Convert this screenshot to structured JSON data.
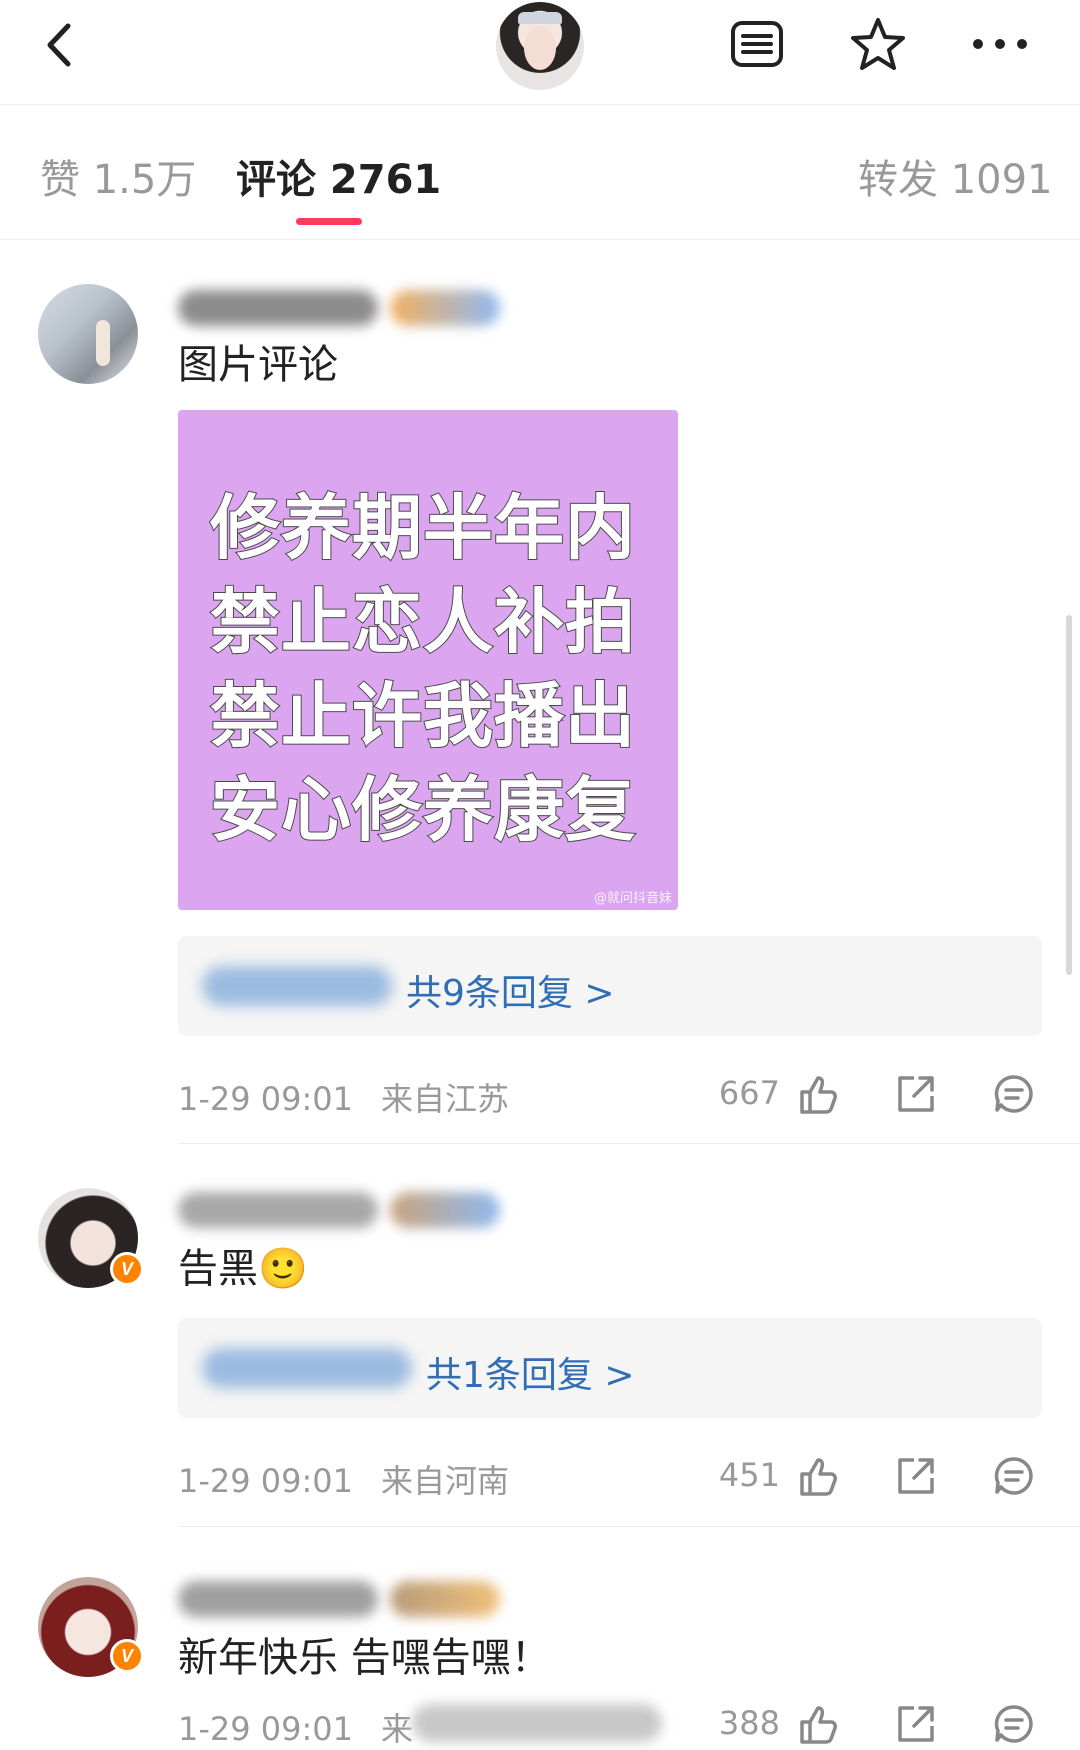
{
  "header": {
    "back_icon": "chevron-left-icon",
    "actions": [
      "list-icon",
      "star-icon",
      "more-icon"
    ]
  },
  "tabs": {
    "likes": "赞 1.5万",
    "comments": "评论 2761",
    "reposts": "转发 1091"
  },
  "comments": [
    {
      "text": "图片评论",
      "image_lines": [
        "修养期半年内",
        "禁止恋人补拍",
        "禁止许我播出",
        "安心修养康复"
      ],
      "image_watermark": "@就问抖音妹",
      "reply_link": "共9条回复 >",
      "time": "1-29 09:01",
      "location": "来自江苏",
      "likes": "667"
    },
    {
      "text": "告黑",
      "emoji": "🙂",
      "reply_link": "共1条回复 >",
      "time": "1-29 09:01",
      "location": "来自河南",
      "likes": "451"
    },
    {
      "text": "新年快乐 告嘿告嘿！",
      "time": "1-29 09:01",
      "location": "来",
      "likes": "388"
    }
  ],
  "colors": {
    "accent": "#ff3b5c",
    "link": "#2f6eb5",
    "verified": "#ff8200",
    "image_bg": "#dba5f0"
  },
  "badge_letter": "V"
}
